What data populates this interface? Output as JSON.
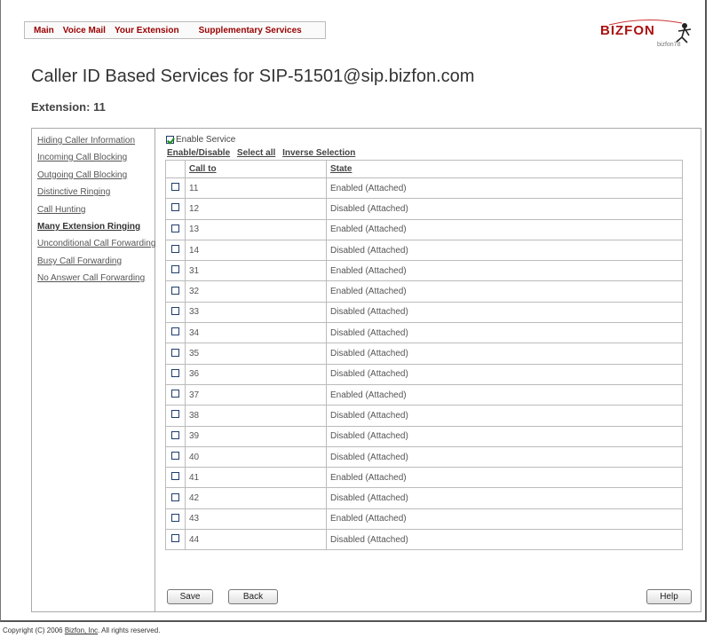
{
  "nav": {
    "items": [
      "Main",
      "Voice Mail",
      "Your Extension",
      "Supplementary Services"
    ]
  },
  "logo": {
    "brand": "BIZFON",
    "sub": "bizfon78"
  },
  "page": {
    "title": "Caller ID Based Services for SIP-51501@sip.bizfon.com",
    "extension_label": "Extension: 11"
  },
  "sidebar": {
    "items": [
      "Hiding Caller Information",
      "Incoming Call Blocking",
      "Outgoing Call Blocking",
      "Distinctive Ringing",
      "Call Hunting",
      "Many Extension Ringing",
      "Unconditional Call Forwarding",
      "Busy Call Forwarding",
      "No Answer Call Forwarding"
    ],
    "active": "Many Extension Ringing"
  },
  "service": {
    "enable_label": "Enable Service",
    "enabled": true,
    "actions": [
      "Enable/Disable",
      "Select all",
      "Inverse Selection"
    ]
  },
  "table": {
    "columns": [
      "Call to",
      "State"
    ],
    "rows": [
      {
        "call_to": "11",
        "state": "Enabled (Attached)"
      },
      {
        "call_to": "12",
        "state": "Disabled (Attached)"
      },
      {
        "call_to": "13",
        "state": "Enabled (Attached)"
      },
      {
        "call_to": "14",
        "state": "Disabled (Attached)"
      },
      {
        "call_to": "31",
        "state": "Enabled (Attached)"
      },
      {
        "call_to": "32",
        "state": "Enabled (Attached)"
      },
      {
        "call_to": "33",
        "state": "Disabled (Attached)"
      },
      {
        "call_to": "34",
        "state": "Disabled (Attached)"
      },
      {
        "call_to": "35",
        "state": "Disabled (Attached)"
      },
      {
        "call_to": "36",
        "state": "Disabled (Attached)"
      },
      {
        "call_to": "37",
        "state": "Enabled (Attached)"
      },
      {
        "call_to": "38",
        "state": "Disabled (Attached)"
      },
      {
        "call_to": "39",
        "state": "Disabled (Attached)"
      },
      {
        "call_to": "40",
        "state": "Disabled (Attached)"
      },
      {
        "call_to": "41",
        "state": "Enabled (Attached)"
      },
      {
        "call_to": "42",
        "state": "Disabled (Attached)"
      },
      {
        "call_to": "43",
        "state": "Enabled (Attached)"
      },
      {
        "call_to": "44",
        "state": "Disabled (Attached)"
      }
    ]
  },
  "buttons": {
    "save": "Save",
    "back": "Back",
    "help": "Help"
  },
  "footer": {
    "prefix": "Copyright (C) 2006 ",
    "link": "Bizfon, Inc",
    "suffix": ". All rights reserved."
  },
  "colors": {
    "nav_text": "#990000",
    "brand": "#aa1111",
    "check": "#1a8a1a"
  }
}
